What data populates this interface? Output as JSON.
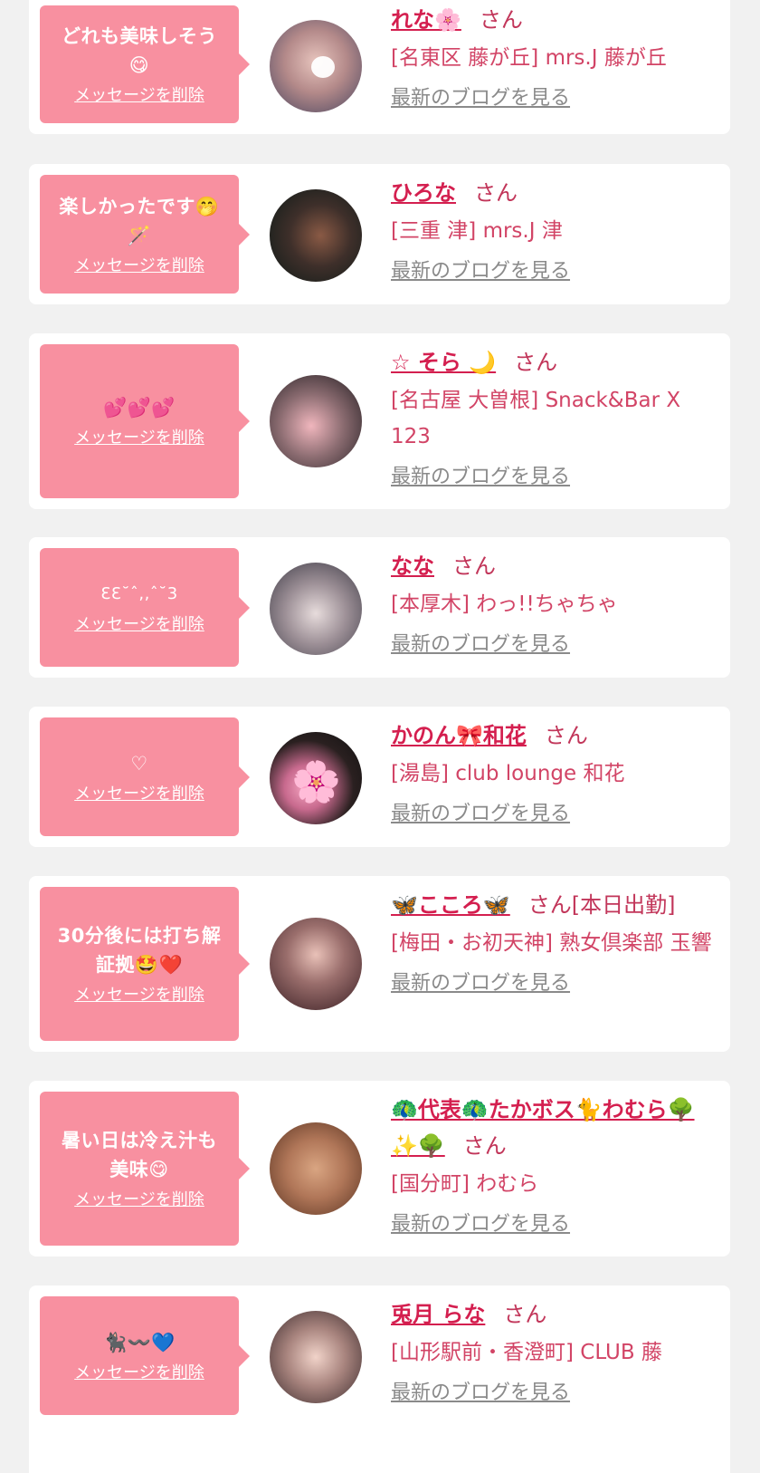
{
  "colors": {
    "page_bg": "#f1f1f1",
    "card_bg": "#ffffff",
    "bubble_bg": "#f890a0",
    "name_text": "#d41f4f",
    "shop_text": "#d24466",
    "blog_link": "#8a8a8a"
  },
  "common": {
    "delete_label": "メッセージを削除",
    "blog_label": "最新のブログを見る"
  },
  "entries": [
    {
      "message": "どれも美味しそう\n😋",
      "name": "れな🌸",
      "honorific": "さん",
      "shop": "[名東区 藤が丘] mrs.J 藤が丘",
      "avatar_icon": "avatar-photo"
    },
    {
      "message": "楽しかったです🤭\n🪄",
      "name": "ひろな",
      "honorific": "さん",
      "shop": "[三重 津] mrs.J 津",
      "avatar_icon": "avatar-photo"
    },
    {
      "message": "💕💕💕",
      "name": "☆ そら 🌙",
      "honorific": "さん",
      "shop": "[名古屋 大曽根] Snack&Bar X 123",
      "avatar_icon": "avatar-photo"
    },
    {
      "message": "ƐƐ˘ˆ,,ˆ˘3",
      "name": "なな",
      "honorific": "さん",
      "shop": "[本厚木] わっ!!ちゃちゃ",
      "avatar_icon": "avatar-photo"
    },
    {
      "message": "♡",
      "name": "かのん🎀和花",
      "honorific": "さん",
      "shop": "[湯島] club lounge 和花",
      "avatar_icon": "avatar-photo"
    },
    {
      "message": "30分後には打ち解\n証拠🤩❤️",
      "name": "🦋こころ🦋",
      "honorific": "さん[本日出勤]",
      "shop": "[梅田・お初天神] 熟女倶楽部 玉響",
      "avatar_icon": "avatar-photo"
    },
    {
      "message": "暑い日は冷え汁も\n美味😋",
      "name": "🦚代表🦚たかボス🐈わむら🌳✨🌳",
      "honorific": "さん",
      "shop": "[国分町] わむら",
      "avatar_icon": "avatar-photo"
    },
    {
      "message": "🐈‍⬛〰️💙",
      "name": "兎月 らな",
      "honorific": "さん",
      "shop": "[山形駅前・香澄町] CLUB 藤",
      "avatar_icon": "avatar-photo"
    }
  ]
}
